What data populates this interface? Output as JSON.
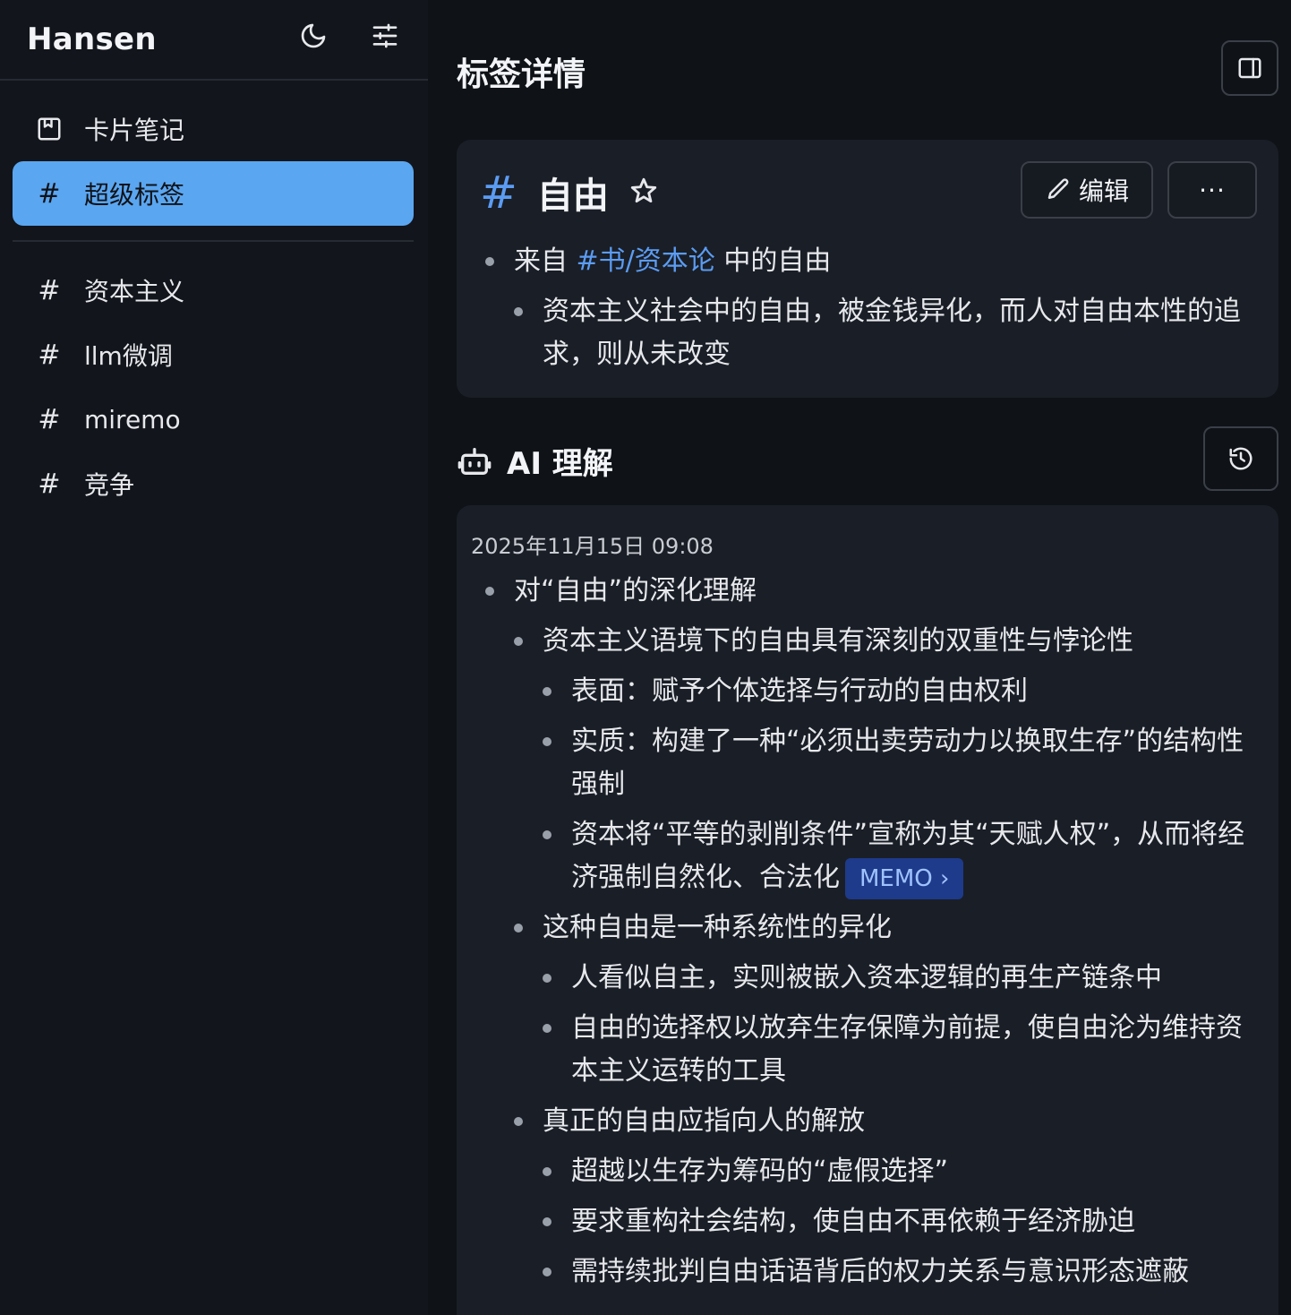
{
  "sidebar": {
    "brand": "Hansen",
    "nav": [
      {
        "label": "卡片笔记",
        "icon": "bookmark-box-icon"
      },
      {
        "label": "超级标签",
        "icon": "hash-icon",
        "active": true
      }
    ],
    "tags": [
      {
        "label": "资本主义"
      },
      {
        "label": "llm微调"
      },
      {
        "label": "miremo"
      },
      {
        "label": "竞争"
      }
    ]
  },
  "main": {
    "title": "标签详情",
    "tag": {
      "hash": "#",
      "name": "自由",
      "edit_label": "编辑",
      "more_label": "···",
      "line1_prefix": "来自",
      "line1_link": "#书/资本论",
      "line1_suffix": "中的自由",
      "line1_child": "资本主义社会中的自由，被金钱异化，而人对自由本性的追求，则从未改变"
    },
    "ai": {
      "title": "AI 理解",
      "date": "2025年11月15日 09:08",
      "root": "对“自由”的深化理解",
      "s1": "资本主义语境下的自由具有深刻的双重性与悖论性",
      "s1a": "表面：赋予个体选择与行动的自由权利",
      "s1b": "实质：构建了一种“必须出卖劳动力以换取生存”的结构性强制",
      "s1c": "资本将“平等的剥削条件”宣称为其“天赋人权”，从而将经济强制自然化、合法化",
      "memo": "MEMO ›",
      "s2": "这种自由是一种系统性的异化",
      "s2a": "人看似自主，实则被嵌入资本逻辑的再生产链条中",
      "s2b": "自由的选择权以放弃生存保障为前提，使自由沦为维持资本主义运转的工具",
      "s3": "真正的自由应指向人的解放",
      "s3a": "超越以生存为筹码的“虚假选择”",
      "s3b": "要求重构社会结构，使自由不再依赖于经济胁迫",
      "s3c": "需持续批判自由话语背后的权力关系与意识形态遮蔽"
    }
  },
  "colors": {
    "accent": "#5ba6f0",
    "link": "#5b9cf3",
    "background": "#0f1217",
    "card": "#1a1e26"
  }
}
